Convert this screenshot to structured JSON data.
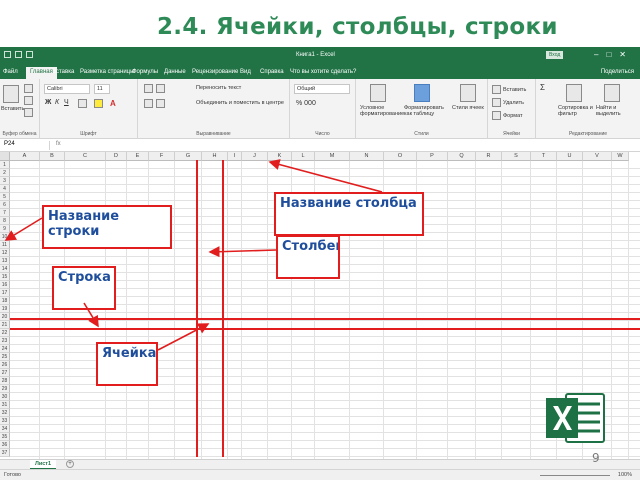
{
  "slide": {
    "title": "2.4. Ячейки, столбцы, строки",
    "page_number": "9"
  },
  "excel": {
    "window_title": "Книга1 - Excel",
    "sign_in": "Вход",
    "tabs": [
      "Файл",
      "Главная",
      "Вставка",
      "Разметка страницы",
      "Формулы",
      "Данные",
      "Рецензирование",
      "Вид",
      "Справка",
      "Что вы хотите сделать?"
    ],
    "active_tab_index": 1,
    "share_label": "Поделиться",
    "ribbon": {
      "paste_label": "Вставить",
      "clipboard_group": "Буфер обмена",
      "font_name": "Calibri",
      "font_size": "11",
      "font_group": "Шрифт",
      "wrap_text": "Переносить текст",
      "merge_center": "Объединить и поместить в центре",
      "alignment_group": "Выравнивание",
      "number_format": "Общий",
      "number_group": "Число",
      "cond_format": "Условное форматирование",
      "format_table": "Форматировать как таблицу",
      "cell_styles": "Стили ячеек",
      "styles_group": "Стили",
      "insert_label": "Вставить",
      "delete_label": "Удалить",
      "format_label": "Формат",
      "cells_group": "Ячейки",
      "sort_filter": "Сортировка и фильтр",
      "find_select": "Найти и выделить",
      "editing_group": "Редактирование"
    },
    "name_box": "P24",
    "fx_label": "fx",
    "columns": [
      "A",
      "B",
      "C",
      "D",
      "E",
      "F",
      "G",
      "H",
      "I",
      "J",
      "K",
      "L",
      "M",
      "N",
      "O",
      "P",
      "Q",
      "R",
      "S",
      "T",
      "U",
      "V",
      "W"
    ],
    "rows": [
      "1",
      "2",
      "3",
      "4",
      "5",
      "6",
      "7",
      "8",
      "9",
      "10",
      "11",
      "12",
      "13",
      "14",
      "15",
      "16",
      "17",
      "18",
      "19",
      "20",
      "21",
      "22",
      "23",
      "24",
      "25",
      "26",
      "27",
      "28",
      "29",
      "30",
      "31",
      "32",
      "33",
      "34",
      "35",
      "36",
      "37"
    ],
    "sheet_tab": "Лист1",
    "add_sheet": "+",
    "status_text": "Готово",
    "zoom": "100%"
  },
  "callouts": {
    "column_name": "Название столбца",
    "row_name": "Название строки",
    "column": "Столбец",
    "row": "Строка",
    "cell": "Ячейка"
  },
  "colors": {
    "title": "#2e8b57",
    "excel_green": "#217346",
    "highlight_red": "#e11d1d",
    "callout_text": "#1f4e9c"
  }
}
